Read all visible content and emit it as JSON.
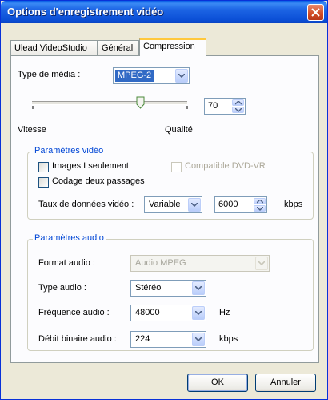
{
  "window": {
    "title": "Options d'enregistrement vidéo"
  },
  "tabs": [
    {
      "label": "Ulead VideoStudio"
    },
    {
      "label": "Général"
    },
    {
      "label": "Compression"
    }
  ],
  "media": {
    "label": "Type de média :",
    "value": "MPEG-2"
  },
  "quality": {
    "value": "70",
    "level_percent": 70,
    "left_label": "Vitesse",
    "right_label": "Qualité"
  },
  "video_params": {
    "legend": "Paramètres vidéo",
    "i_frames_only": "Images I seulement",
    "i_frames_checked": false,
    "dvd_vr": "Compatible DVD-VR",
    "dvd_vr_checked": false,
    "two_pass": "Codage deux passages",
    "two_pass_checked": false,
    "rate_label": "Taux de données vidéo :",
    "rate_mode": "Variable",
    "rate_value": "6000",
    "rate_unit": "kbps"
  },
  "audio_params": {
    "legend": "Paramètres audio",
    "format_label": "Format audio :",
    "format_value": "Audio MPEG",
    "type_label": "Type audio :",
    "type_value": "Stéréo",
    "freq_label": "Fréquence audio :",
    "freq_value": "48000",
    "freq_unit": "Hz",
    "bitrate_label": "Débit binaire audio :",
    "bitrate_value": "224",
    "bitrate_unit": "kbps"
  },
  "buttons": {
    "ok": "OK",
    "cancel": "Annuler"
  }
}
